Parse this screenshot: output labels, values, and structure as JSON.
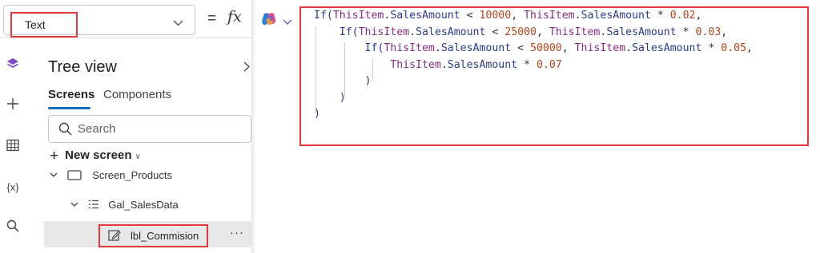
{
  "property_bar": {
    "selected_property": "Text",
    "equals": "=",
    "fx_label": "fx"
  },
  "formula": {
    "lines": [
      [
        [
          "kw",
          "If("
        ],
        [
          "obj",
          "ThisItem"
        ],
        [
          "op",
          "."
        ],
        [
          "kw",
          "SalesAmount"
        ],
        [
          "op",
          " < "
        ],
        [
          "num",
          "10000"
        ],
        [
          "op",
          ", "
        ],
        [
          "obj",
          "ThisItem"
        ],
        [
          "op",
          "."
        ],
        [
          "kw",
          "SalesAmount"
        ],
        [
          "op",
          " * "
        ],
        [
          "num",
          "0.02"
        ],
        [
          "op",
          ","
        ]
      ],
      [
        [
          "op",
          "    "
        ],
        [
          "kw",
          "If("
        ],
        [
          "obj",
          "ThisItem"
        ],
        [
          "op",
          "."
        ],
        [
          "kw",
          "SalesAmount"
        ],
        [
          "op",
          " < "
        ],
        [
          "num",
          "25000"
        ],
        [
          "op",
          ", "
        ],
        [
          "obj",
          "ThisItem"
        ],
        [
          "op",
          "."
        ],
        [
          "kw",
          "SalesAmount"
        ],
        [
          "op",
          " * "
        ],
        [
          "num",
          "0.03"
        ],
        [
          "op",
          ","
        ]
      ],
      [
        [
          "op",
          "        "
        ],
        [
          "kw",
          "If("
        ],
        [
          "obj",
          "ThisItem"
        ],
        [
          "op",
          "."
        ],
        [
          "kw",
          "SalesAmount"
        ],
        [
          "op",
          " < "
        ],
        [
          "num",
          "50000"
        ],
        [
          "op",
          ", "
        ],
        [
          "obj",
          "ThisItem"
        ],
        [
          "op",
          "."
        ],
        [
          "kw",
          "SalesAmount"
        ],
        [
          "op",
          " * "
        ],
        [
          "num",
          "0.05"
        ],
        [
          "op",
          ","
        ]
      ],
      [
        [
          "op",
          "            "
        ],
        [
          "obj",
          "ThisItem"
        ],
        [
          "op",
          "."
        ],
        [
          "kw",
          "SalesAmount"
        ],
        [
          "op",
          " * "
        ],
        [
          "num",
          "0.07"
        ]
      ],
      [
        [
          "op",
          "        "
        ],
        [
          "kw",
          ")"
        ]
      ],
      [
        [
          "op",
          "    "
        ],
        [
          "kw",
          ")"
        ]
      ],
      [
        [
          "kw",
          ")"
        ]
      ]
    ]
  },
  "tree_view": {
    "title": "Tree view",
    "tabs": [
      "Screens",
      "Components"
    ],
    "search_placeholder": "Search",
    "new_screen_label": "New screen",
    "items": {
      "screen": "Screen_Products",
      "gallery": "Gal_SalesData",
      "selected_control": "lbl_Commision",
      "more": "···"
    }
  },
  "colors": {
    "highlight_border": "#e0393e",
    "accent": "#0f6cbd",
    "keyword": "#2a3c86",
    "object": "#8a2d83",
    "number": "#b5461c"
  },
  "icons": [
    "chevron-down-icon",
    "layers-icon",
    "plus-icon",
    "table-icon",
    "variables-icon",
    "search-icon",
    "copilot-icon",
    "screen-icon",
    "gallery-icon",
    "edit-icon"
  ]
}
